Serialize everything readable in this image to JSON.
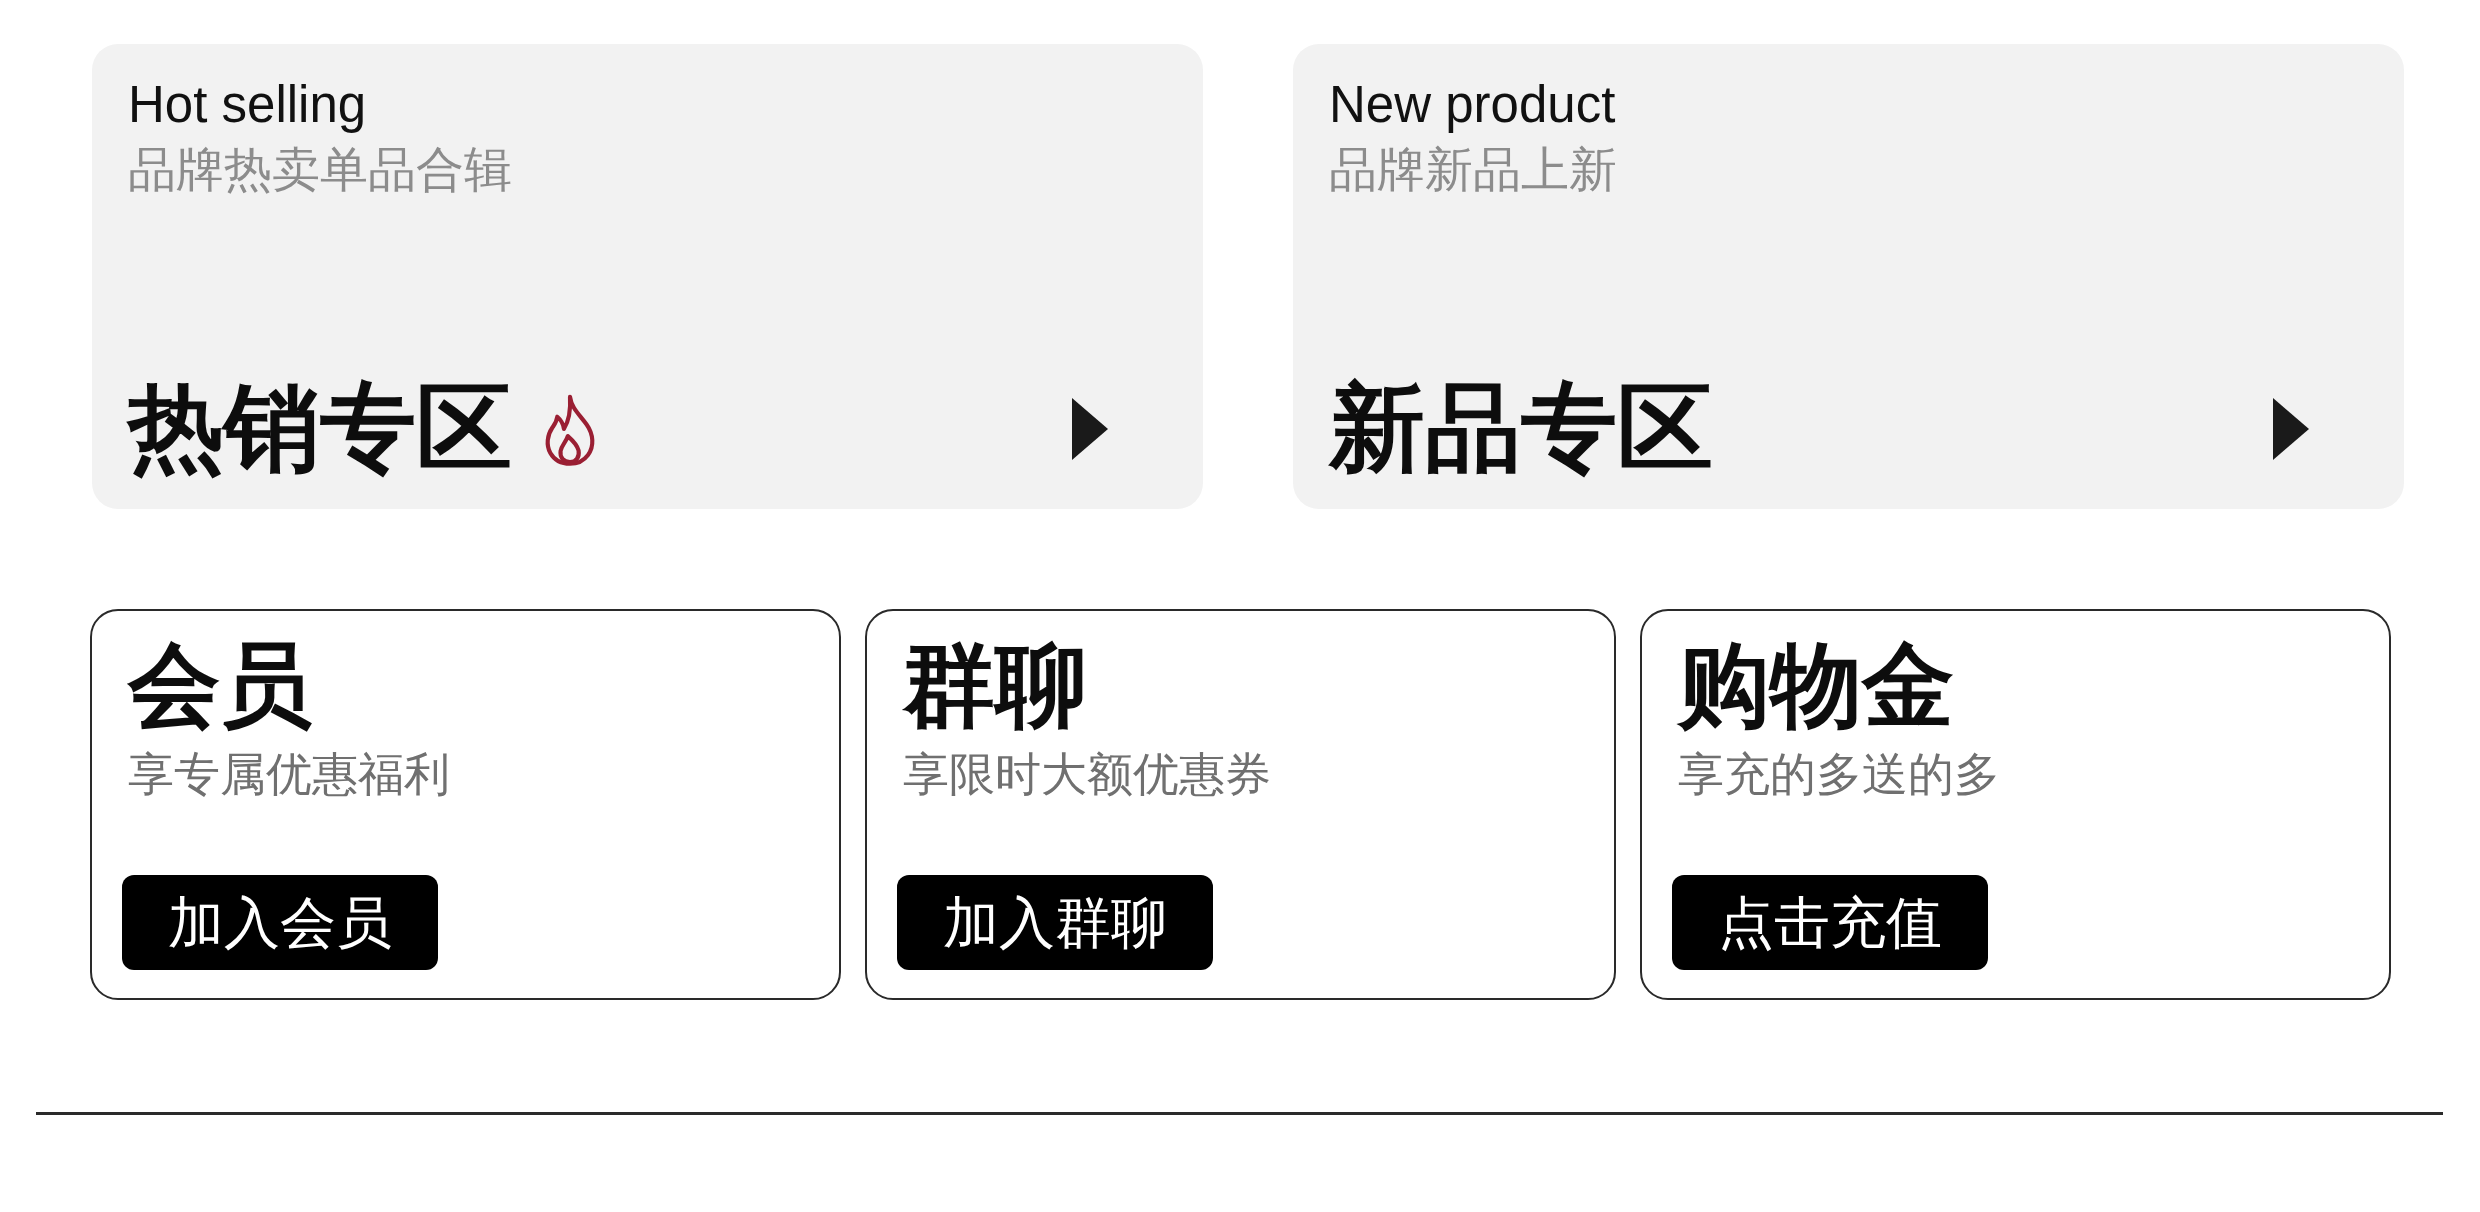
{
  "promo_cards": [
    {
      "title": "Hot selling",
      "subtitle": "品牌热卖单品合辑",
      "heading": "热销专区",
      "hot": true
    },
    {
      "title": "New product",
      "subtitle": "品牌新品上新",
      "heading": "新品专区",
      "hot": false
    }
  ],
  "benefit_cards": [
    {
      "title": "会员",
      "subtitle": "享专属优惠福利",
      "button": "加入会员"
    },
    {
      "title": "群聊",
      "subtitle": "享限时大额优惠券",
      "button": "加入群聊"
    },
    {
      "title": "购物金",
      "subtitle": "享充的多送的多",
      "button": "点击充值"
    }
  ]
}
